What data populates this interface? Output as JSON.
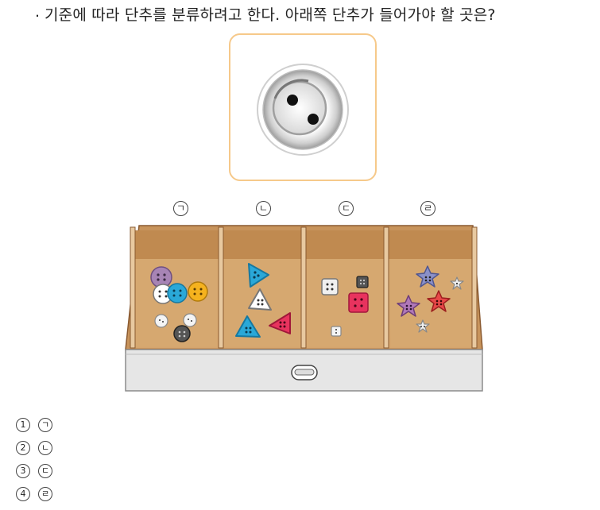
{
  "question": {
    "marker": ".",
    "text": "기준에 따라 단추를 분류하려고 한다. 아래쪽 단추가 들어가야 할 곳은?"
  },
  "compartments": [
    {
      "label": "ㄱ",
      "button_shape": "round"
    },
    {
      "label": "ㄴ",
      "button_shape": "triangle"
    },
    {
      "label": "ㄷ",
      "button_shape": "square"
    },
    {
      "label": "ㄹ",
      "button_shape": "star"
    }
  ],
  "choices": [
    {
      "number": "1",
      "answer": "ㄱ"
    },
    {
      "number": "2",
      "answer": "ㄴ"
    },
    {
      "number": "3",
      "answer": "ㄷ"
    },
    {
      "number": "4",
      "answer": "ㄹ"
    }
  ],
  "colors": {
    "card_border": "#f6c98a",
    "drawer_wood": "#c8945c",
    "drawer_inner": "#d4a46c",
    "drawer_front": "#e4e4e4"
  }
}
